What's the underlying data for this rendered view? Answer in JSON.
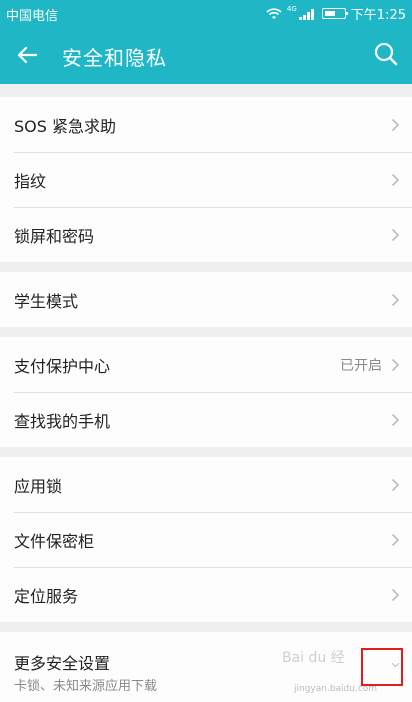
{
  "status_bar": {
    "carrier": "中国电信",
    "network": "4G",
    "time": "下午1:25"
  },
  "header": {
    "title": "安全和隐私",
    "back_icon": "arrow-left-icon",
    "search_icon": "search-icon"
  },
  "groups": [
    {
      "items": [
        {
          "label": "SOS 紧急求助"
        },
        {
          "label": "指纹"
        },
        {
          "label": "锁屏和密码"
        }
      ]
    },
    {
      "items": [
        {
          "label": "学生模式"
        }
      ]
    },
    {
      "items": [
        {
          "label": "支付保护中心",
          "value": "已开启"
        },
        {
          "label": "查找我的手机"
        }
      ]
    },
    {
      "items": [
        {
          "label": "应用锁"
        },
        {
          "label": "文件保密柜"
        },
        {
          "label": "定位服务"
        }
      ]
    },
    {
      "items": [
        {
          "label": "更多安全设置",
          "sublabel": "卡锁、未知来源应用下载"
        }
      ]
    }
  ],
  "watermark": {
    "text": "Bai du 经验",
    "sub": "jingyan.baidu.com"
  },
  "colors": {
    "accent": "#1fb7c6",
    "highlight": "#e02020"
  }
}
